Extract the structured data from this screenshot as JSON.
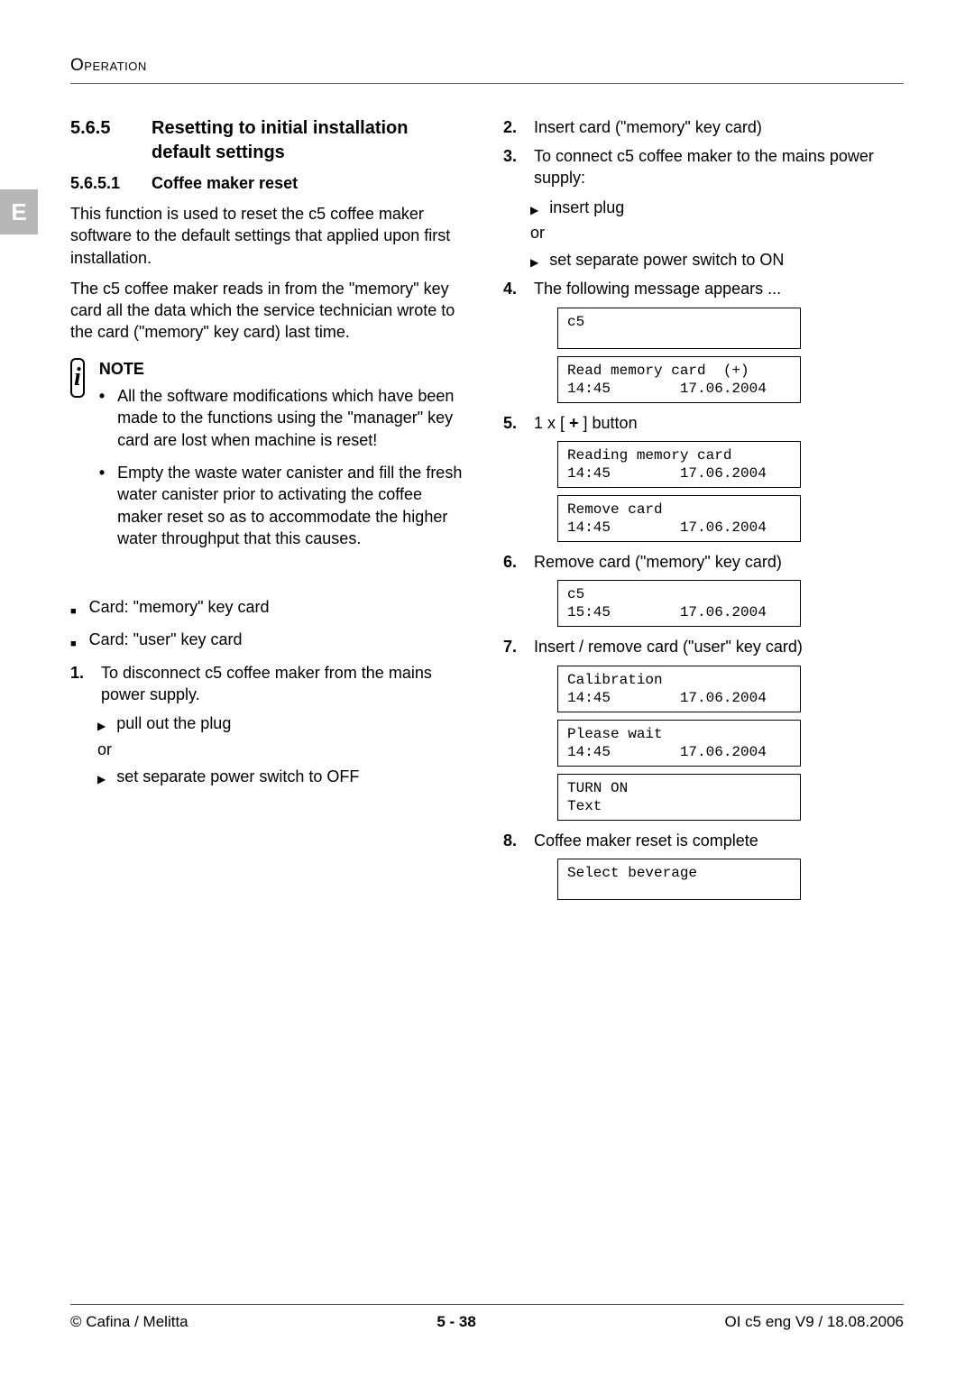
{
  "header": {
    "section_label": "Operation"
  },
  "side_tab": "E",
  "left": {
    "sec_num": "5.6.5",
    "sec_title": "Resetting to initial installation default settings",
    "sub_num": "5.6.5.1",
    "sub_title": "Coffee maker reset",
    "p1": "This function is used to reset the c5 coffee maker software to the default settings that applied upon first installation.",
    "p2": "The c5 coffee maker reads in from the \"memory\" key card all the data which the service technician wrote to the card (\"memory\" key card) last time.",
    "note_title": "NOTE",
    "notes": [
      "All the software modifications which have been made to the functions using the \"manager\" key card are lost when machine is reset!",
      "Empty the waste water canister and fill the fresh water canister prior to activating the coffee maker reset so as to accommodate the higher water throughput that this causes."
    ],
    "cards": [
      "Card: \"memory\" key card",
      "Card: \"user\" key card"
    ],
    "step1": {
      "num": "1.",
      "text": "To disconnect c5 coffee maker from the mains power supply."
    },
    "step1_sub": [
      "pull out the plug",
      "set separate power switch to OFF"
    ],
    "or": "or"
  },
  "right": {
    "step2": {
      "num": "2.",
      "text": "Insert card (\"memory\" key card)"
    },
    "step3": {
      "num": "3.",
      "text": "To connect c5 coffee maker to the mains power supply:"
    },
    "step3_sub": [
      "insert plug",
      "set separate power switch to ON"
    ],
    "or": "or",
    "step4": {
      "num": "4.",
      "text": "The following message appears ..."
    },
    "lcd4a": "c5\n",
    "lcd4b": "Read memory card  (+)\n14:45        17.06.2004",
    "step5_pre": "1 x [",
    "step5_btn": " + ",
    "step5_post": "] button",
    "step5_num": "5.",
    "lcd5a": "Reading memory card\n14:45        17.06.2004",
    "lcd5b": "Remove card\n14:45        17.06.2004",
    "step6": {
      "num": "6.",
      "text": "Remove card (\"memory\" key card)"
    },
    "lcd6": "c5\n15:45        17.06.2004",
    "step7": {
      "num": "7.",
      "text": "Insert / remove card (\"user\" key card)"
    },
    "lcd7a": "Calibration\n14:45        17.06.2004",
    "lcd7b": "Please wait\n14:45        17.06.2004",
    "lcd7c": "TURN ON\nText",
    "step8": {
      "num": "8.",
      "text": "Coffee maker reset is complete"
    },
    "lcd8": "Select beverage\n"
  },
  "footer": {
    "left": "© Cafina / Melitta",
    "center": "5 - 38",
    "right": "OI c5 eng V9 / 18.08.2006"
  }
}
